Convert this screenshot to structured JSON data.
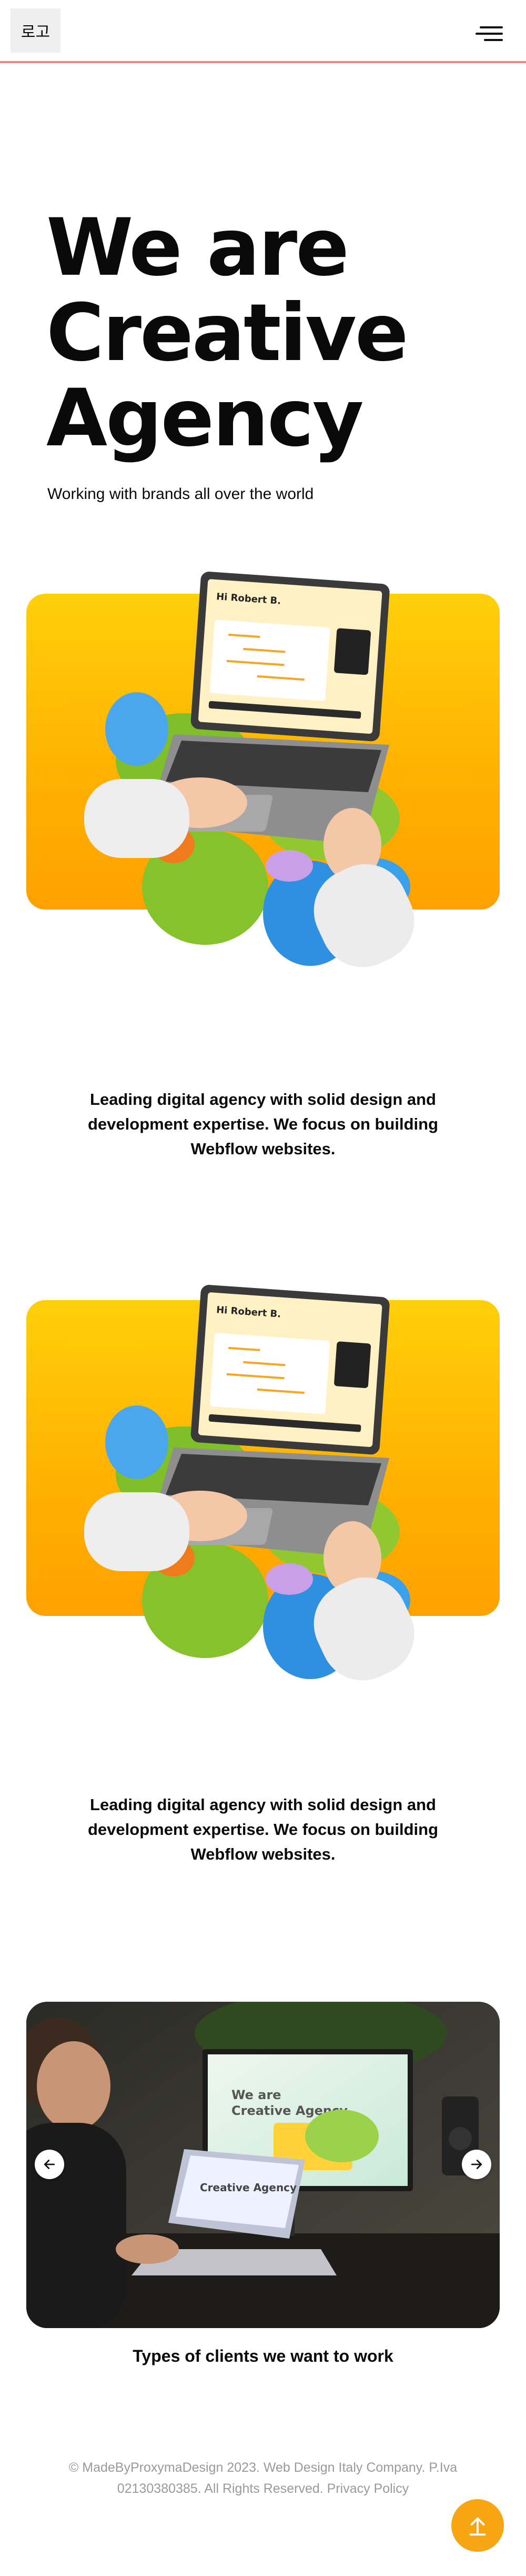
{
  "header": {
    "logo_text": "로고",
    "menu_icon": "hamburger-menu-icon"
  },
  "hero": {
    "title_lines": [
      "We are",
      "Creative",
      "Agency"
    ],
    "subtitle": "Working with brands all over the world"
  },
  "illustration": {
    "laptop_greeting": "Hi Robert B.",
    "colors": {
      "card_top": "#ffcf0b",
      "card_bottom": "#ffa100"
    }
  },
  "sections": [
    {
      "text": "Leading digital agency with solid design and development expertise. We focus on building Webflow websites."
    },
    {
      "text": "Leading digital agency with solid design and development expertise. We focus on building Webflow websites."
    }
  ],
  "slider": {
    "screen_text_1": "We are",
    "screen_text_2": "Creative Agency",
    "prev_icon": "arrow-left-icon",
    "next_icon": "arrow-right-icon",
    "caption": "Types of clients we want to work"
  },
  "footer": {
    "text": "© MadeByProxymaDesign 2023. Web Design Italy Company. P.Iva 02130380385. All Rights Reserved. Privacy Policy"
  },
  "back_to_top_icon": "arrow-up-icon",
  "colors": {
    "accent": "#f7a513",
    "header_border": "#e88b85"
  }
}
